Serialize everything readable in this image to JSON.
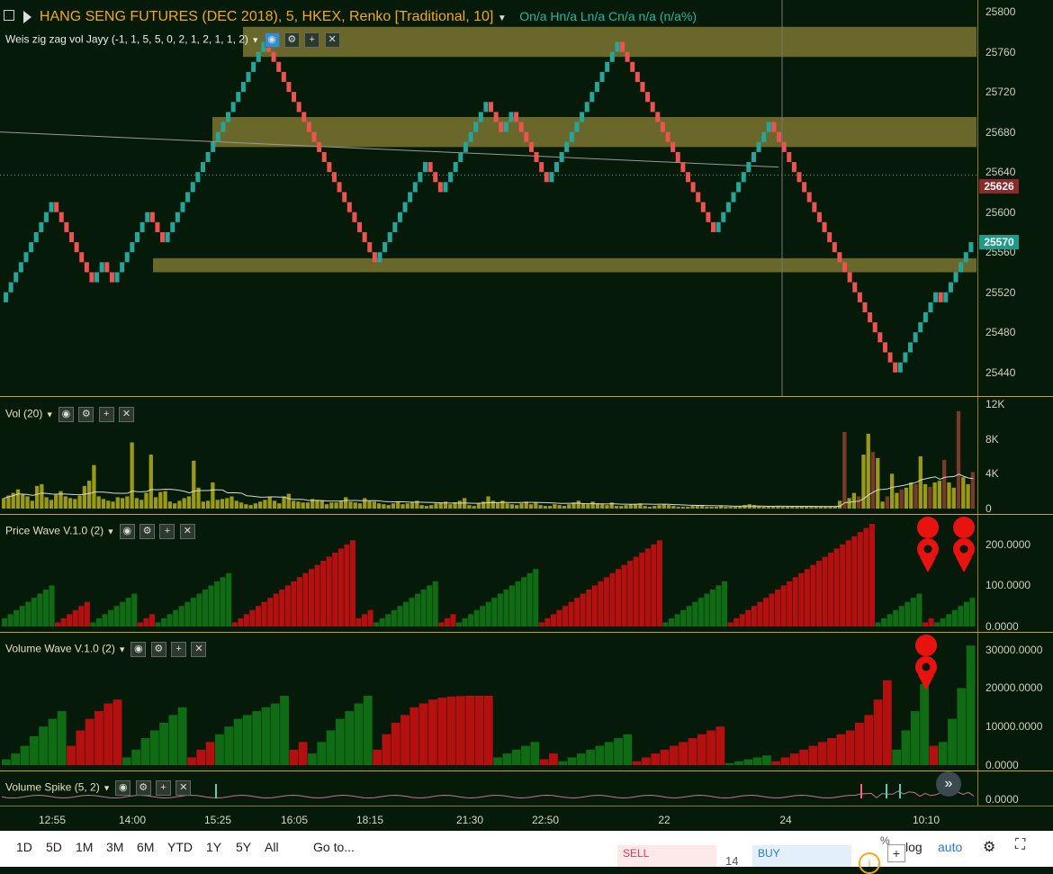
{
  "header": {
    "symbol_title": "HANG SENG FUTURES (DEC 2018), 5, HKEX, Renko [Traditional, 10]",
    "ohlc": "On/a  Hn/a  Ln/a  Cn/a  n/a (n/a%)",
    "indicator": "Weis zig zag vol Jayy (-1, 1, 5, 5, 0, 2, 1, 2, 1, 1, 2)"
  },
  "panes": {
    "vol_label": "Vol (20)",
    "price_wave_label": "Price Wave V.1.0 (2)",
    "volume_wave_label": "Volume Wave V.1.0 (2)",
    "volume_spike_label": "Volume Spike (5, 2)"
  },
  "colors": {
    "background": "#051a08",
    "up_brick": "#26a69a",
    "down_brick": "#ef5350",
    "zone": "#7d7630",
    "wave_up": "#0f6b14",
    "wave_down": "#b3100f",
    "vol_bar": "#9a9a18",
    "vol_bar_down": "#7a3a2a",
    "axis_gold": "#c9a227",
    "marker": "#e8120f"
  },
  "price_axis": {
    "ticks": [
      "25800",
      "25760",
      "25720",
      "25680",
      "25640",
      "25600",
      "25560",
      "25520",
      "25480",
      "25440"
    ],
    "current_price": "25626",
    "last_price": "25570"
  },
  "vol_axis": {
    "ticks": [
      "12K",
      "8K",
      "4K",
      "0"
    ]
  },
  "price_wave_axis": {
    "ticks": [
      "200.0000",
      "100.0000",
      "0.0000"
    ]
  },
  "volume_wave_axis": {
    "ticks": [
      "30000.0000",
      "20000.0000",
      "10000.0000",
      "0.0000"
    ]
  },
  "volume_spike_axis": {
    "ticks": [
      "0.0000"
    ]
  },
  "time_axis": {
    "labels": [
      "12:55",
      "14:00",
      "15:25",
      "16:05",
      "18:15",
      "21:30",
      "22:50",
      "22",
      "24",
      "10:10"
    ]
  },
  "toolbar": {
    "ranges": [
      "1D",
      "5D",
      "1M",
      "3M",
      "6M",
      "YTD",
      "1Y",
      "5Y",
      "All"
    ],
    "goto": "Go to...",
    "sell_label": "SELL",
    "buy_label": "BUY",
    "spread": "14",
    "pct": "%",
    "log": "log",
    "auto": "auto"
  },
  "chart_data": [
    {
      "type": "renko",
      "title": "HANG SENG FUTURES (DEC 2018), 5, HKEX, Renko [Traditional, 10]",
      "brick_size": 10,
      "ylim": [
        25420,
        25810
      ],
      "closes": [
        25520,
        25530,
        25540,
        25550,
        25560,
        25570,
        25580,
        25590,
        25600,
        25610,
        25600,
        25590,
        25580,
        25570,
        25560,
        25550,
        25540,
        25530,
        25540,
        25550,
        25540,
        25530,
        25540,
        25550,
        25560,
        25570,
        25580,
        25590,
        25600,
        25590,
        25580,
        25570,
        25580,
        25590,
        25600,
        25610,
        25620,
        25630,
        25640,
        25650,
        25660,
        25670,
        25680,
        25690,
        25700,
        25710,
        25720,
        25730,
        25740,
        25750,
        25760,
        25770,
        25760,
        25750,
        25740,
        25730,
        25720,
        25710,
        25700,
        25690,
        25680,
        25670,
        25660,
        25650,
        25640,
        25630,
        25620,
        25610,
        25600,
        25590,
        25580,
        25570,
        25560,
        25550,
        25560,
        25570,
        25580,
        25590,
        25600,
        25610,
        25620,
        25630,
        25640,
        25650,
        25640,
        25630,
        25620,
        25630,
        25640,
        25650,
        25660,
        25670,
        25680,
        25690,
        25700,
        25710,
        25700,
        25690,
        25680,
        25690,
        25700,
        25690,
        25680,
        25670,
        25660,
        25650,
        25640,
        25630,
        25640,
        25650,
        25660,
        25670,
        25680,
        25690,
        25700,
        25710,
        25720,
        25730,
        25740,
        25750,
        25760,
        25770,
        25760,
        25750,
        25740,
        25730,
        25720,
        25710,
        25700,
        25690,
        25680,
        25670,
        25660,
        25650,
        25640,
        25630,
        25620,
        25610,
        25600,
        25590,
        25580,
        25590,
        25600,
        25610,
        25620,
        25630,
        25640,
        25650,
        25660,
        25670,
        25680,
        25690,
        25680,
        25670,
        25660,
        25650,
        25640,
        25630,
        25620,
        25610,
        25600,
        25590,
        25580,
        25570,
        25560,
        25550,
        25540,
        25530,
        25520,
        25510,
        25500,
        25490,
        25480,
        25470,
        25460,
        25450,
        25440,
        25450,
        25460,
        25470,
        25480,
        25490,
        25500,
        25510,
        25520,
        25510,
        25520,
        25530,
        25540,
        25550,
        25560,
        25570
      ],
      "zones": [
        [
          25755,
          25785
        ],
        [
          25665,
          25695
        ],
        [
          25540,
          25554
        ]
      ],
      "trendline": [
        [
          0,
          25680
        ],
        [
          865,
          25645
        ]
      ],
      "ticks": [
        25800,
        25760,
        25720,
        25680,
        25640,
        25600,
        25560,
        25520,
        25480,
        25440
      ]
    },
    {
      "type": "bar",
      "title": "Vol (20)",
      "ylim": [
        0,
        12000
      ],
      "values": [
        1200,
        1500,
        1800,
        2200,
        1600,
        1400,
        900,
        2600,
        2800,
        1300,
        1000,
        1600,
        2000,
        1400,
        1200,
        1100,
        1500,
        2600,
        3200,
        5000,
        1400,
        1100,
        900,
        800,
        1300,
        1200,
        1400,
        7600,
        1200,
        1000,
        1800,
        6200,
        1300,
        1900,
        2000,
        800,
        600,
        900,
        1200,
        1400,
        5500,
        2400,
        800,
        900,
        3000,
        1000,
        1100,
        1200,
        1400,
        900,
        700,
        500,
        400,
        600,
        800,
        1000,
        1300,
        900,
        600,
        1400,
        1700,
        900,
        800,
        700,
        700,
        1100,
        1000,
        900,
        500,
        700,
        700,
        900,
        1300,
        800,
        700,
        600,
        1200,
        900,
        800,
        600,
        500,
        400,
        600,
        800,
        500,
        600,
        700,
        900,
        400,
        300,
        400,
        600,
        700,
        800,
        500,
        700,
        900,
        1200,
        400,
        300,
        600,
        800,
        1400,
        900,
        700,
        900,
        600,
        500,
        400,
        600,
        800,
        500,
        700,
        400,
        300,
        300,
        500,
        400,
        300,
        500,
        700,
        900,
        600,
        500,
        800,
        600,
        500,
        400,
        700,
        300,
        300,
        400,
        500,
        500,
        600,
        300,
        200,
        300,
        400,
        500,
        400,
        300,
        200,
        200,
        200,
        300,
        300,
        300,
        200,
        200,
        200,
        300,
        200,
        200,
        200,
        300,
        400,
        500,
        400,
        300,
        200,
        200,
        200,
        300,
        200,
        200,
        200,
        200,
        200,
        200,
        200,
        200,
        200,
        200,
        200,
        200,
        900,
        8800,
        1200,
        1800,
        1400,
        6200,
        8600,
        6500,
        5800,
        800,
        1400,
        4000,
        1800,
        2200,
        2400,
        3000,
        2800,
        6000,
        2800,
        2500,
        3000,
        3200,
        5600,
        3000,
        2400,
        11200,
        3600,
        2800,
        4200
      ],
      "ticks": [
        "12K",
        "8K",
        "4K",
        "0"
      ]
    },
    {
      "type": "bar",
      "title": "Price Wave V.1.0 (2)",
      "ylim": [
        0,
        250
      ],
      "series": [
        {
          "dir": "up",
          "values": [
            20,
            30,
            40,
            50,
            60,
            70,
            80,
            90,
            100
          ]
        },
        {
          "dir": "down",
          "values": [
            10,
            20,
            30,
            40,
            50,
            60
          ]
        },
        {
          "dir": "up",
          "values": [
            10,
            20,
            30,
            40,
            50,
            60,
            70,
            80
          ]
        },
        {
          "dir": "down",
          "values": [
            10,
            20,
            30
          ]
        },
        {
          "dir": "up",
          "values": [
            10,
            20,
            30,
            40,
            50,
            60,
            70,
            80,
            90,
            100,
            110,
            120,
            130
          ]
        },
        {
          "dir": "down",
          "values": [
            10,
            20,
            30,
            40,
            50,
            60,
            70,
            80,
            90,
            100,
            110,
            120,
            130,
            140,
            150,
            160,
            170,
            180,
            190,
            200,
            210
          ]
        },
        {
          "dir": "down",
          "values": [
            20,
            30,
            40
          ]
        },
        {
          "dir": "up",
          "values": [
            10,
            20,
            30,
            40,
            50,
            60,
            70,
            80,
            90,
            100,
            110
          ]
        },
        {
          "dir": "down",
          "values": [
            10,
            20,
            30
          ]
        },
        {
          "dir": "up",
          "values": [
            10,
            20,
            30,
            40,
            50,
            60,
            70,
            80,
            90,
            100,
            110,
            120,
            130,
            140
          ]
        },
        {
          "dir": "down",
          "values": [
            10,
            20,
            30,
            40,
            50,
            60,
            70,
            80,
            90,
            100,
            110,
            120,
            130,
            140,
            150,
            160,
            170,
            180,
            190,
            200,
            210
          ]
        },
        {
          "dir": "up",
          "values": [
            10,
            20,
            30,
            40,
            50,
            60,
            70,
            80,
            90,
            100,
            110
          ]
        },
        {
          "dir": "down",
          "values": [
            10,
            20,
            30,
            40,
            50,
            60,
            70,
            80,
            90,
            100,
            110,
            120,
            130,
            140,
            150,
            160,
            170,
            180,
            190,
            200,
            210,
            220,
            230,
            240,
            250
          ]
        },
        {
          "dir": "up",
          "values": [
            10,
            20,
            30,
            40,
            50,
            60,
            70,
            80
          ]
        },
        {
          "dir": "down",
          "values": [
            10,
            20
          ]
        },
        {
          "dir": "up",
          "values": [
            10,
            20,
            30,
            40,
            50,
            60,
            70
          ]
        }
      ],
      "markers": 2,
      "ticks": [
        "200.0000",
        "100.0000",
        "0.0000"
      ]
    },
    {
      "type": "bar",
      "title": "Volume Wave V.1.0 (2)",
      "ylim": [
        0,
        32000
      ],
      "series": [
        {
          "dir": "up",
          "values": [
            1500,
            3000,
            5000,
            7500,
            10000,
            12000,
            14000
          ]
        },
        {
          "dir": "down",
          "values": [
            5000,
            9000,
            12000,
            14000,
            16000,
            17000
          ]
        },
        {
          "dir": "up",
          "values": [
            2000,
            4000,
            7000,
            9000,
            11000,
            13000,
            15000
          ]
        },
        {
          "dir": "down",
          "values": [
            2000,
            4000,
            6000
          ]
        },
        {
          "dir": "up",
          "values": [
            8000,
            10000,
            12000,
            13000,
            14000,
            15000,
            16000,
            18000
          ]
        },
        {
          "dir": "down",
          "values": [
            4000,
            6000
          ]
        },
        {
          "dir": "up",
          "values": [
            3000,
            6000,
            9000,
            12000,
            14000,
            16000,
            18000
          ]
        },
        {
          "dir": "down",
          "values": [
            4000,
            8000,
            11000,
            13000,
            15000,
            16000,
            17000,
            17500,
            17800,
            17900,
            18000,
            18000,
            18000
          ]
        },
        {
          "dir": "up",
          "values": [
            2000,
            3000,
            4000,
            5000,
            6000
          ]
        },
        {
          "dir": "down",
          "values": [
            1500,
            3000
          ]
        },
        {
          "dir": "up",
          "values": [
            1000,
            2000,
            3000,
            4000,
            5000,
            6000,
            7000,
            8000
          ]
        },
        {
          "dir": "down",
          "values": [
            1000,
            2000,
            3000,
            4000,
            5000,
            6000,
            7000,
            8000,
            9000,
            10000
          ]
        },
        {
          "dir": "up",
          "values": [
            500,
            1000,
            1500,
            2000,
            2500
          ]
        },
        {
          "dir": "down",
          "values": [
            1000,
            2000,
            3000,
            4000,
            5000,
            6000,
            7000,
            8000,
            9000,
            11000,
            13000,
            17000,
            22000
          ]
        },
        {
          "dir": "up",
          "values": [
            4000,
            9000,
            14000,
            21000
          ]
        },
        {
          "dir": "down",
          "values": [
            5000
          ]
        },
        {
          "dir": "up",
          "values": [
            6000,
            12000,
            20000,
            31000
          ]
        }
      ],
      "markers": 1,
      "ticks": [
        "30000.0000",
        "20000.0000",
        "10000.0000",
        "0.0000"
      ]
    },
    {
      "type": "line",
      "title": "Volume Spike (5, 2)",
      "ticks": [
        "0.0000"
      ]
    }
  ]
}
